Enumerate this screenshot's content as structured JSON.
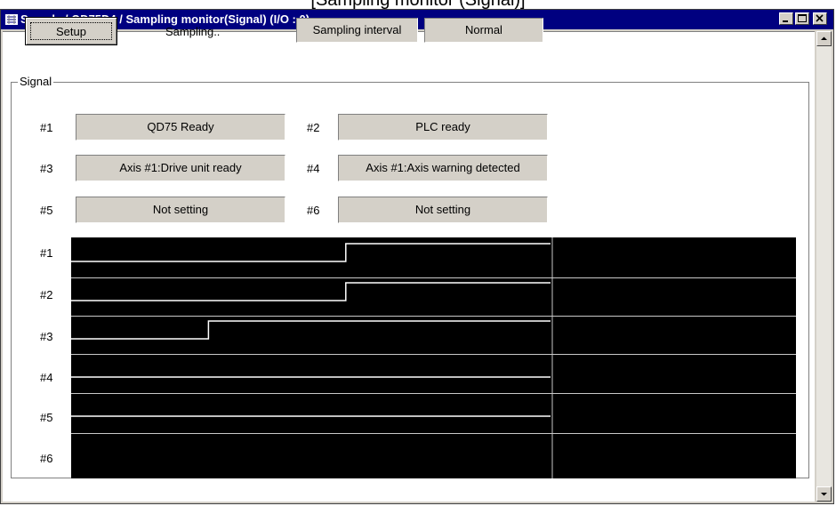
{
  "caption": "[Sampling monitor (Signal)]",
  "window": {
    "title": "Sample / QD75D4 / Sampling monitor(Signal) (I/O : 0)",
    "buttons": [
      "minimize",
      "maximize",
      "close"
    ]
  },
  "toolbar": {
    "setup_label": "Setup",
    "status_text": "Sampling..",
    "sampling_interval_label": "Sampling interval",
    "sampling_interval_value": "Normal"
  },
  "signal_group": {
    "title": "Signal",
    "signals": [
      {
        "id": "#1",
        "name": "QD75 Ready"
      },
      {
        "id": "#2",
        "name": "PLC ready"
      },
      {
        "id": "#3",
        "name": "Axis #1:Drive unit ready"
      },
      {
        "id": "#4",
        "name": "Axis #1:Axis warning detected"
      },
      {
        "id": "#5",
        "name": "Not setting"
      },
      {
        "id": "#6",
        "name": "Not setting"
      }
    ]
  },
  "waveform": {
    "channels": [
      {
        "id": "#1",
        "trace": [
          0,
          0,
          0,
          0,
          1,
          1,
          1
        ],
        "visible": true
      },
      {
        "id": "#2",
        "trace": [
          0,
          0,
          0,
          0,
          1,
          1,
          1
        ],
        "visible": true
      },
      {
        "id": "#3",
        "trace": [
          0,
          0,
          1,
          1,
          1,
          1,
          1
        ],
        "visible": true
      },
      {
        "id": "#4",
        "trace": [
          0,
          0,
          0,
          0,
          0,
          0,
          0
        ],
        "visible": true
      },
      {
        "id": "#5",
        "trace": [
          0,
          0,
          0,
          0,
          0,
          0,
          0
        ],
        "visible": true
      },
      {
        "id": "#6",
        "trace": [],
        "visible": false
      }
    ],
    "colors": {
      "background": "#000000",
      "trace": "#ffffff",
      "grid": "#c8c8c8"
    }
  }
}
